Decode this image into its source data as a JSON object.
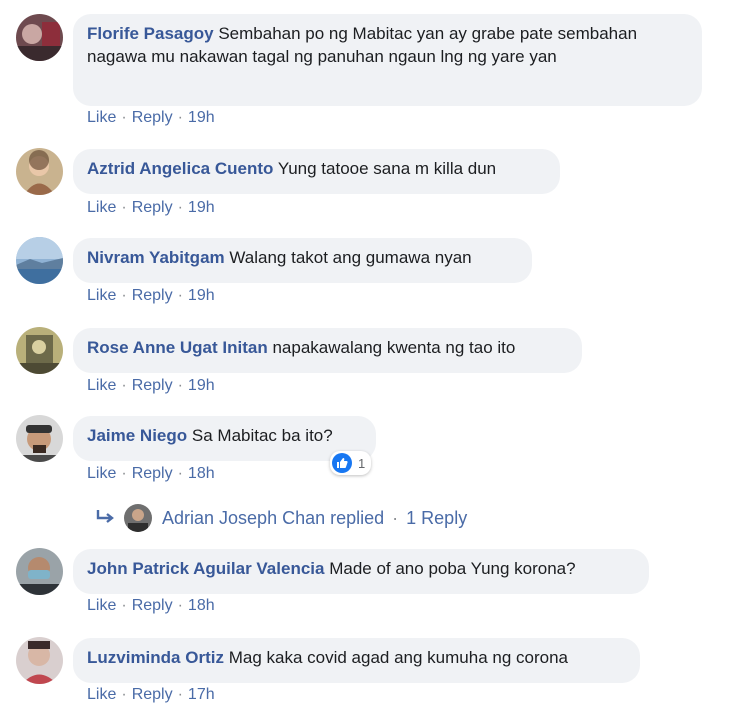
{
  "comments": [
    {
      "author": "Florife Pasagoy",
      "text": "Sembahan po ng Mabitac yan ay grabe pate sembahan nagawa mu nakawan tagal ng panuhan ngaun lng ng yare yan",
      "like": "Like",
      "reply": "Reply",
      "time": "19h"
    },
    {
      "author": "Aztrid Angelica Cuento",
      "text": "Yung tatooe sana m killa dun",
      "like": "Like",
      "reply": "Reply",
      "time": "19h"
    },
    {
      "author": "Nivram Yabitgam",
      "text": "Walang takot ang gumawa nyan",
      "like": "Like",
      "reply": "Reply",
      "time": "19h"
    },
    {
      "author": "Rose Anne Ugat Initan",
      "text": "napakawalang kwenta ng tao ito",
      "like": "Like",
      "reply": "Reply",
      "time": "19h"
    },
    {
      "author": "Jaime Niego",
      "text": "Sa Mabitac ba ito?",
      "like": "Like",
      "reply": "Reply",
      "time": "18h",
      "reaction_count": "1"
    },
    {
      "author": "John Patrick Aguilar Valencia",
      "text": "Made of ano poba Yung korona?",
      "like": "Like",
      "reply": "Reply",
      "time": "18h"
    },
    {
      "author": "Luzviminda Ortiz",
      "text": "Mag kaka covid agad ang kumuha ng corona",
      "like": "Like",
      "reply": "Reply",
      "time": "17h"
    }
  ],
  "replies": {
    "replier": "Adrian Joseph Chan replied",
    "separator": "·",
    "count": "1 Reply"
  },
  "colors": {
    "link": "#385898",
    "bubble": "#f0f2f5",
    "like": "#1877f2"
  }
}
